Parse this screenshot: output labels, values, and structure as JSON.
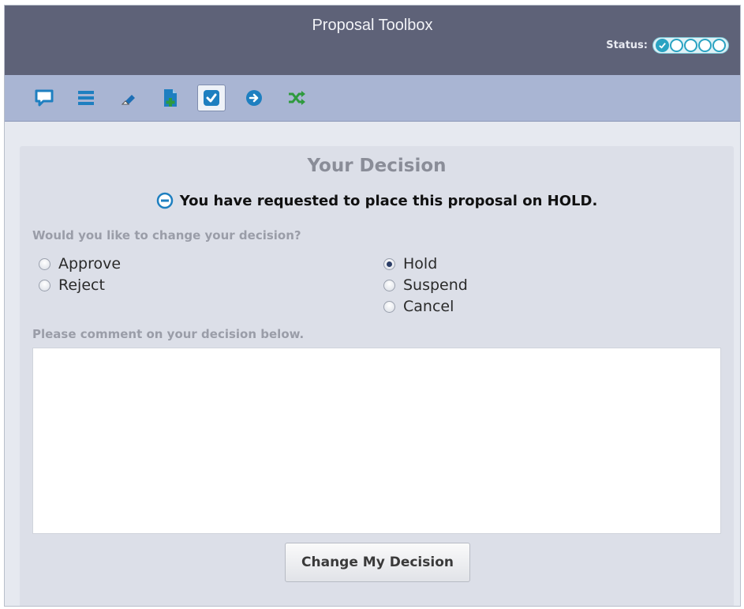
{
  "window": {
    "title": "Proposal Toolbox",
    "status_label": "Status:",
    "status_steps": [
      {
        "state": "complete",
        "icon": "check-icon"
      },
      {
        "state": "pending",
        "icon": "circle-icon"
      },
      {
        "state": "pending",
        "icon": "circle-icon"
      },
      {
        "state": "pending",
        "icon": "circle-icon"
      },
      {
        "state": "pending",
        "icon": "circle-icon"
      }
    ]
  },
  "toolbar": {
    "tools": [
      {
        "name": "comments",
        "icon": "speech-bubble-icon",
        "active": false
      },
      {
        "name": "list",
        "icon": "list-icon",
        "active": false
      },
      {
        "name": "edit",
        "icon": "eraser-icon",
        "active": false
      },
      {
        "name": "add-document",
        "icon": "add-document-icon",
        "active": false
      },
      {
        "name": "decision",
        "icon": "checkmark-icon",
        "active": true
      },
      {
        "name": "forward",
        "icon": "arrow-circle-icon",
        "active": false
      },
      {
        "name": "shuffle",
        "icon": "shuffle-icon",
        "active": false
      }
    ]
  },
  "decision": {
    "heading": "Your Decision",
    "notice": "You have requested to place this proposal on HOLD.",
    "notice_icon": "minus-circle-icon",
    "change_prompt": "Would you like to change your decision?",
    "options_left": [
      {
        "label": "Approve",
        "checked": false
      },
      {
        "label": "Reject",
        "checked": false
      }
    ],
    "options_right": [
      {
        "label": "Hold",
        "checked": true
      },
      {
        "label": "Suspend",
        "checked": false
      },
      {
        "label": "Cancel",
        "checked": false
      }
    ],
    "comment_prompt": "Please comment on your decision below.",
    "comment_value": "",
    "submit_label": "Change My Decision"
  },
  "colors": {
    "titlebar": "#5e6278",
    "toolbar": "#a9b5d3",
    "accent": "#2aa3c2",
    "icon_blue": "#1e7fc0",
    "icon_green": "#2e9a3e"
  }
}
